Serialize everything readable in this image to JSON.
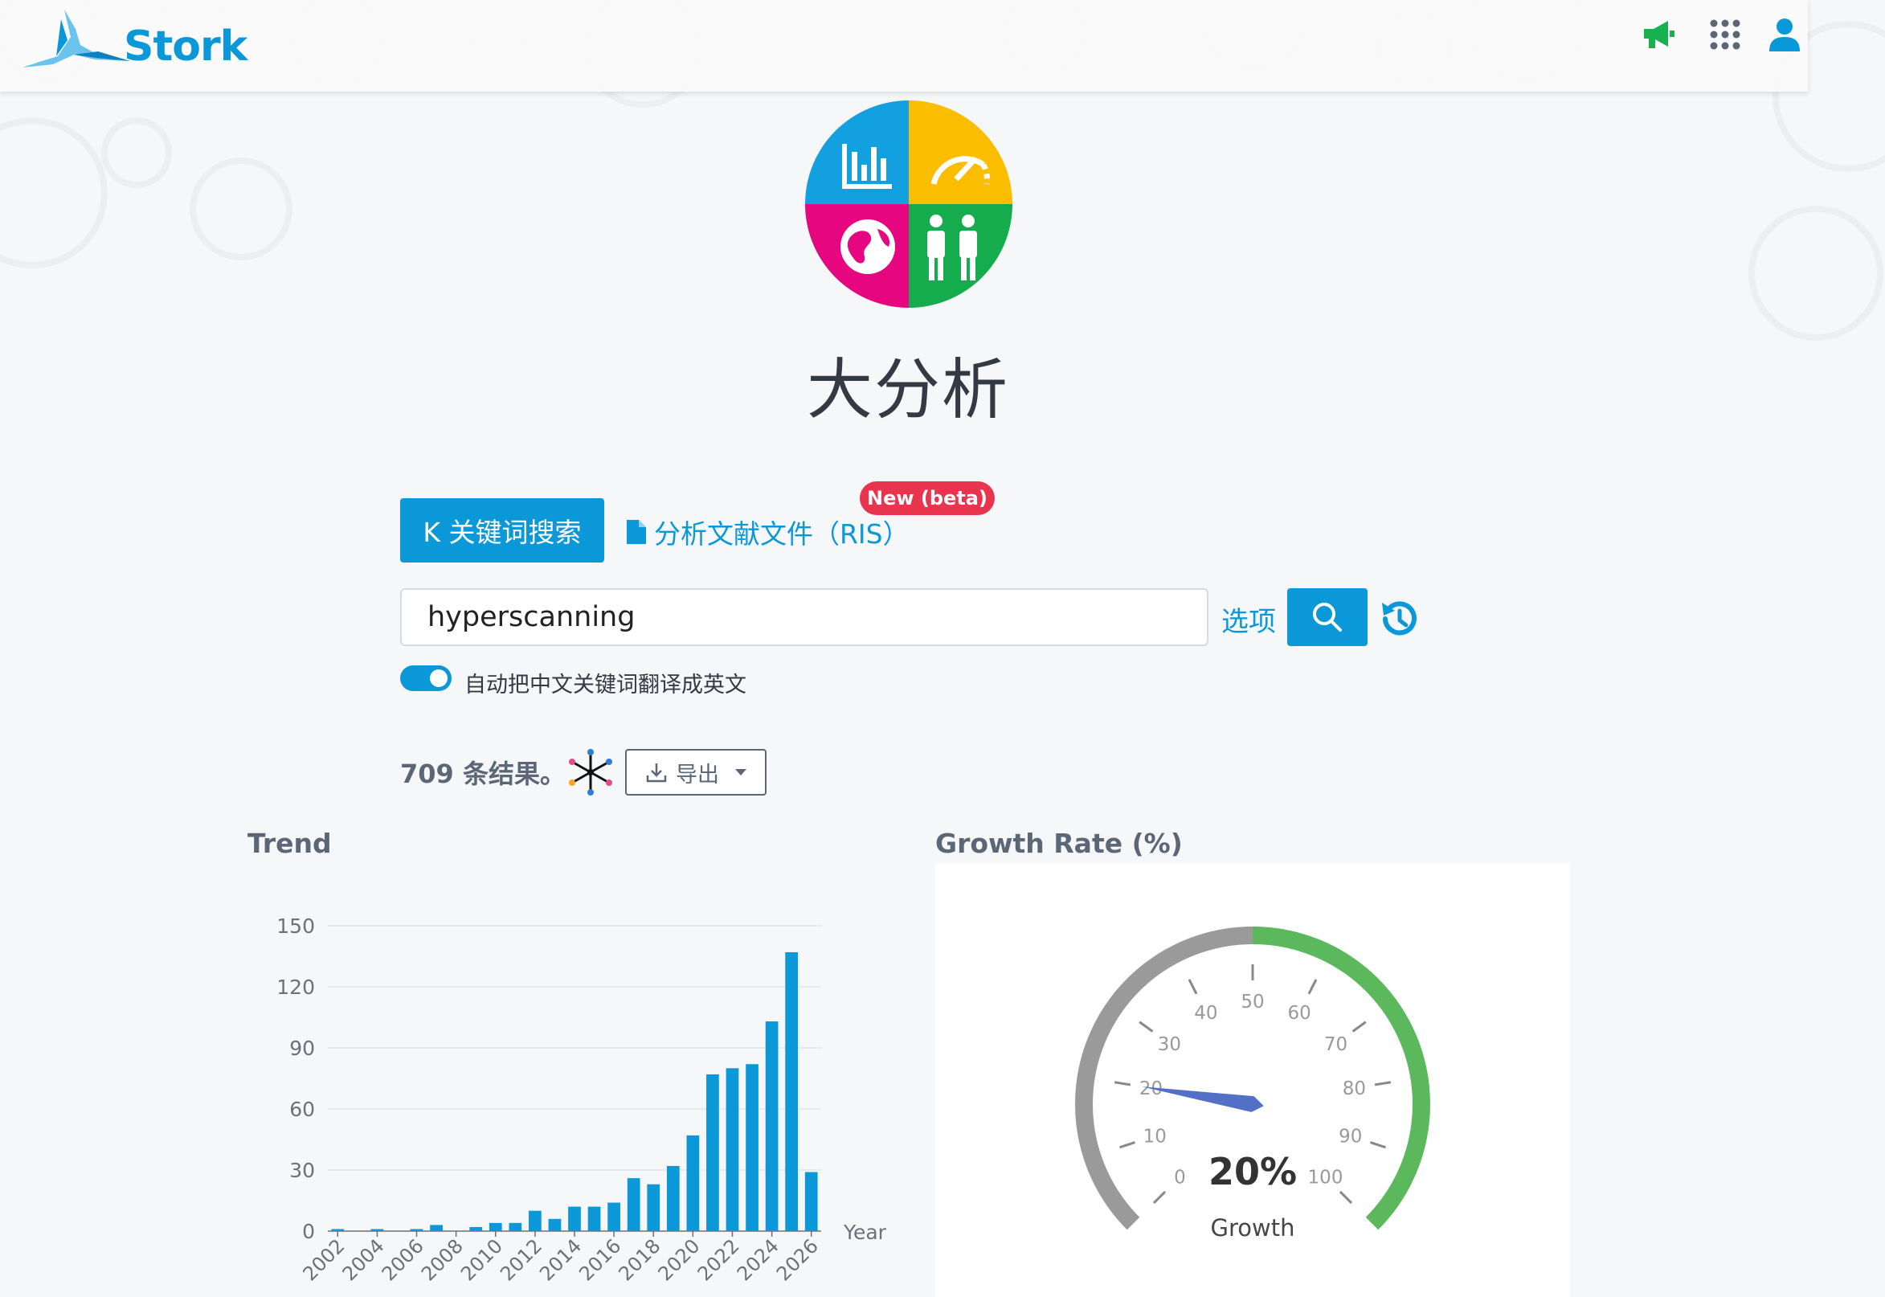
{
  "header": {
    "brand": "Stork",
    "icons": [
      "megaphone-icon",
      "apps-grid-icon",
      "user-icon"
    ]
  },
  "hero": {
    "logo_icons": [
      "bar-chart-icon",
      "speedometer-icon",
      "globe-icon",
      "people-icon"
    ],
    "logo_colors": [
      "#13a0e0",
      "#fbbd00",
      "#e6067f",
      "#15ac4e"
    ],
    "title": "大分析"
  },
  "tabs": {
    "keyword": "K 关键词搜索",
    "ris": "分析文献文件（RIS）",
    "new_badge": "New (beta)"
  },
  "search": {
    "value": "hyperscanning",
    "options_label": "选项"
  },
  "translate_toggle": {
    "label": "自动把中文关键词翻译成英文",
    "on": true
  },
  "results": {
    "count_text": "709 条结果。",
    "export_label": "导出"
  },
  "trend": {
    "title": "Trend"
  },
  "growth": {
    "title": "Growth Rate (%)"
  },
  "colors": {
    "primary": "#0b98d8",
    "badge": "#e8354d",
    "gauge_grey": "#9a9a9a",
    "gauge_green": "#5cb85c",
    "needle": "#5470c6"
  },
  "chart_data": [
    {
      "type": "bar",
      "xlabel": "Year",
      "ylabel": "",
      "ylim": [
        0,
        150
      ],
      "yticks": [
        0,
        30,
        60,
        90,
        120,
        150
      ],
      "grid": true,
      "categories": [
        "2002",
        "2003",
        "2004",
        "2005",
        "2006",
        "2007",
        "2008",
        "2009",
        "2010",
        "2011",
        "2012",
        "2013",
        "2014",
        "2015",
        "2016",
        "2017",
        "2018",
        "2019",
        "2020",
        "2021",
        "2022",
        "2023",
        "2024",
        "2025",
        "2026"
      ],
      "xtick_labels": [
        "2002",
        "2004",
        "2006",
        "2008",
        "2010",
        "2012",
        "2014",
        "2016",
        "2018",
        "2020",
        "2022",
        "2024",
        "2026"
      ],
      "values": [
        1,
        0,
        1,
        0,
        1,
        3,
        0,
        2,
        4,
        4,
        10,
        6,
        12,
        12,
        14,
        26,
        23,
        32,
        47,
        77,
        80,
        82,
        103,
        137,
        29
      ],
      "color": "#0b98d8"
    },
    {
      "type": "gauge",
      "min": 0,
      "max": 100,
      "value": 20,
      "ticks": [
        0,
        10,
        20,
        30,
        40,
        50,
        60,
        70,
        80,
        90,
        100
      ],
      "value_label": "20%",
      "label": "Growth"
    }
  ]
}
